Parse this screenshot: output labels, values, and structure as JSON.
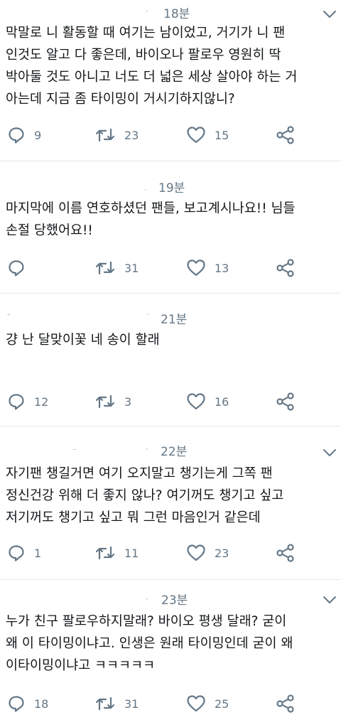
{
  "tweets": [
    {
      "time": "18분",
      "lines": [
        "막말로 니 활동할 때 여기는 남이었고, 거기가 니 팬",
        "인것도 알고 다 좋은데, 바이오나 팔로우 영원히 딱",
        "박아둘 것도 아니고 너도 더 넓은 세상 살아야 하는 거",
        "아는데 지금 좀 타이밍이 거시기하지않니?"
      ],
      "replies": "9",
      "retweets": "23",
      "likes": "15"
    },
    {
      "time": "19분",
      "lines": [
        "마지막에 이름 연호하셨던 팬들, 보고계시나요!! 님들",
        "손절 당했어요!!"
      ],
      "replies": "",
      "retweets": "31",
      "likes": "13"
    },
    {
      "time": "21분",
      "lines": [
        "걍 난 달맞이꽃 네 송이 할래"
      ],
      "replies": "12",
      "retweets": "3",
      "likes": "16"
    },
    {
      "time": "22분",
      "lines": [
        "자기팬 챙길거면 여기 오지말고 챙기는게 그쪽 팬",
        "정신건강 위해 더 좋지 않나? 여기꺼도 챙기고 싶고",
        "저기꺼도 챙기고 싶고 뭐 그런 마음인거 같은데"
      ],
      "replies": "1",
      "retweets": "11",
      "likes": "23"
    },
    {
      "time": "23분",
      "lines": [
        "누가 친구 팔로우하지말래? 바이오 평생 달래? 굳이",
        "왜 이 타이밍이냐고. 인생은 원래 타이밍인데 굳이 왜",
        "이타이밍이냐고 ㅋㅋㅋㅋㅋ"
      ],
      "replies": "18",
      "retweets": "31",
      "likes": "25"
    }
  ],
  "icons": {
    "reply": "reply-icon",
    "retweet": "retweet-icon",
    "like": "heart-icon",
    "share": "share-icon",
    "more": "chevron-down-icon"
  },
  "colors": {
    "icon": "#657786",
    "divider": "#e1e8ed",
    "text": "#14171a"
  }
}
